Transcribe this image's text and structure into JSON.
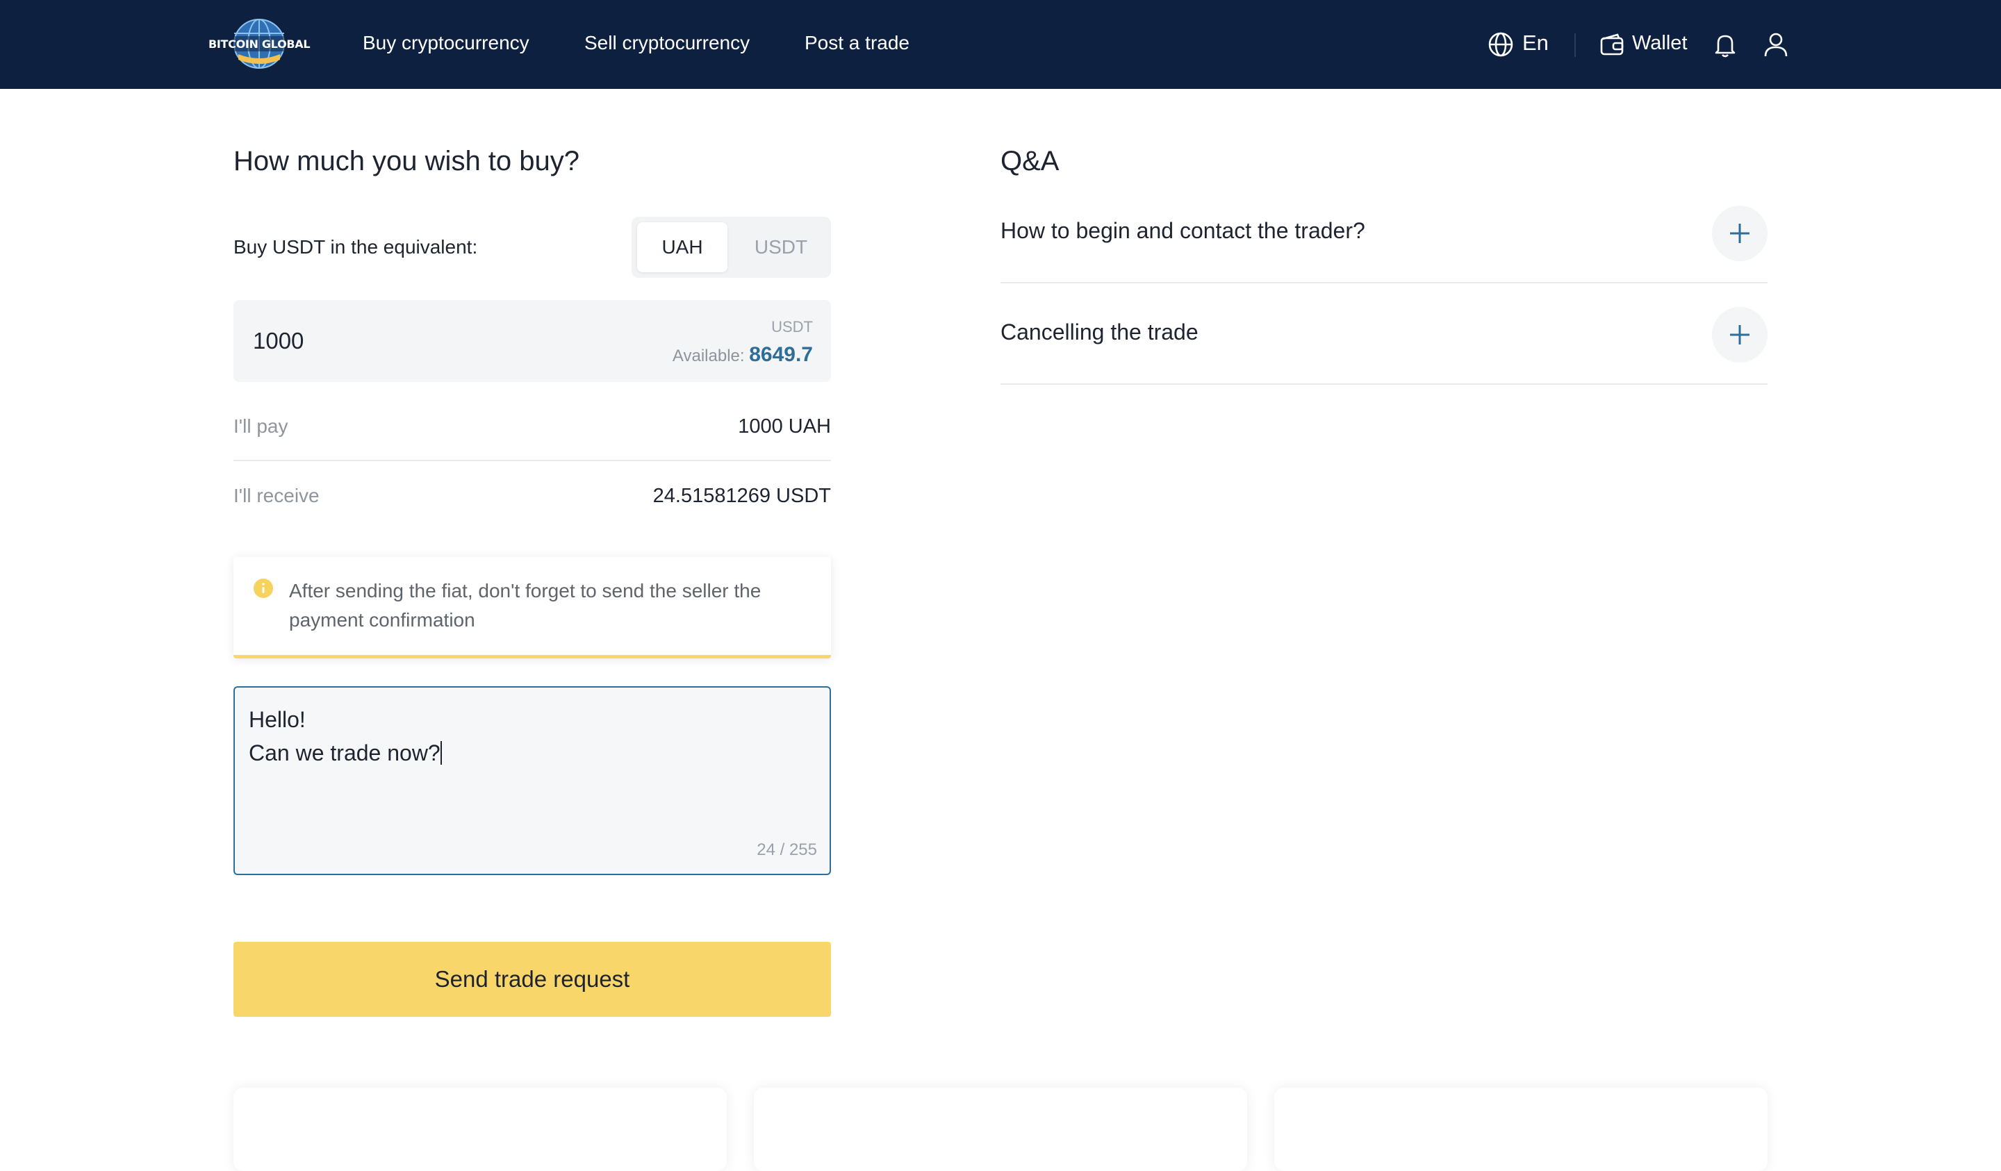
{
  "header": {
    "logo_text": "BITCOIN GLOBAL",
    "nav": {
      "buy": "Buy cryptocurrency",
      "sell": "Sell cryptocurrency",
      "post": "Post a trade"
    },
    "language": "En",
    "wallet": "Wallet",
    "icons": [
      "globe-icon",
      "wallet-icon",
      "bell-icon",
      "user-icon"
    ]
  },
  "buy_form": {
    "title": "How much you wish to buy?",
    "equivalent_label": "Buy USDT in the equivalent:",
    "currency_toggle": {
      "options": [
        "UAH",
        "USDT"
      ],
      "selected": "UAH"
    },
    "amount": {
      "value": "1000",
      "currency": "USDT",
      "available_label": "Available:",
      "available_value": "8649.7"
    },
    "pay_label": "I'll pay",
    "pay_value": "1000 UAH",
    "receive_label": "I'll receive",
    "receive_value": "24.51581269 USDT",
    "notice": "After sending the fiat, don't forget to send the seller the payment confirmation",
    "message": {
      "text": "Hello!\nCan we trade now?",
      "counter": "24 / 255"
    },
    "submit": "Send trade request"
  },
  "qa": {
    "title": "Q&A",
    "items": [
      {
        "question": "How to begin and contact the trader?"
      },
      {
        "question": "Cancelling the trade"
      }
    ]
  },
  "colors": {
    "header_bg": "#0e2040",
    "accent_yellow": "#f8d66a",
    "link_blue": "#2e6e99"
  }
}
